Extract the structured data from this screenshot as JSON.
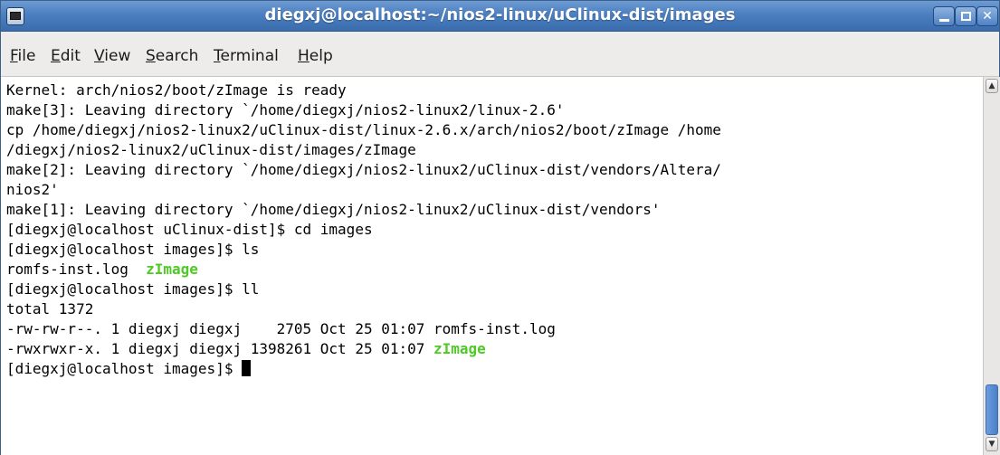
{
  "window": {
    "title": "diegxj@localhost:~/nios2-linux/uClinux-dist/images",
    "buttons": [
      "minimize-icon",
      "maximize-icon",
      "close-icon"
    ]
  },
  "menubar": {
    "items": [
      {
        "mnemonic": "F",
        "rest": "ile"
      },
      {
        "mnemonic": "E",
        "rest": "dit"
      },
      {
        "mnemonic": "V",
        "rest": "iew"
      },
      {
        "mnemonic": "S",
        "rest": "earch"
      },
      {
        "mnemonic": "T",
        "rest": "erminal"
      },
      {
        "mnemonic": "H",
        "rest": "elp"
      }
    ]
  },
  "terminal": {
    "colors": {
      "background": "#ffffff",
      "text": "#000000",
      "executable": "#4fc926"
    },
    "lines": [
      "Kernel: arch/nios2/boot/zImage is ready",
      "make[3]: Leaving directory `/home/diegxj/nios2-linux2/linux-2.6'",
      "cp /home/diegxj/nios2-linux2/uClinux-dist/linux-2.6.x/arch/nios2/boot/zImage /home",
      "/diegxj/nios2-linux2/uClinux-dist/images/zImage",
      "make[2]: Leaving directory `/home/diegxj/nios2-linux2/uClinux-dist/vendors/Altera/",
      "nios2'",
      "make[1]: Leaving directory `/home/diegxj/nios2-linux2/uClinux-dist/vendors'",
      "[diegxj@localhost uClinux-dist]$ cd images",
      "[diegxj@localhost images]$ ls"
    ],
    "ls_output": {
      "plain": "romfs-inst.log  ",
      "exe": "zImage"
    },
    "prompt_ll": "[diegxj@localhost images]$ ll",
    "total": "total 1372",
    "ll_rows": [
      {
        "prefix": "-rw-rw-r--. 1 diegxj diegxj    2705 Oct 25 01:07 ",
        "name": "romfs-inst.log",
        "exe": false
      },
      {
        "prefix": "-rwxrwxr-x. 1 diegxj diegxj 1398261 Oct 25 01:07 ",
        "name": "zImage",
        "exe": true
      }
    ],
    "final_prompt": "[diegxj@localhost images]$ "
  }
}
